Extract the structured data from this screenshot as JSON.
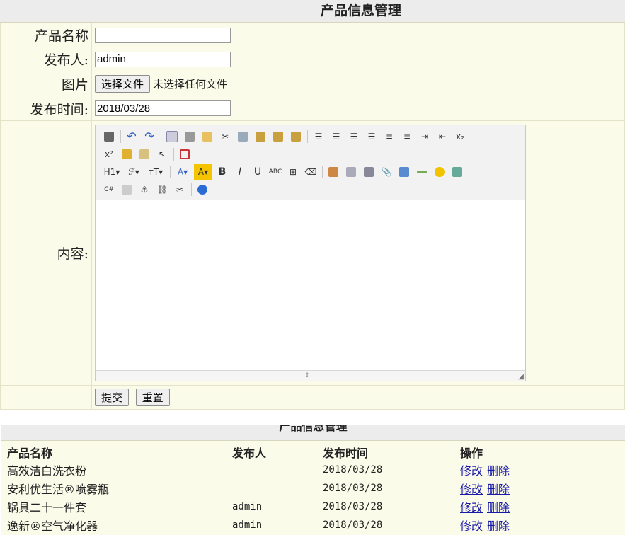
{
  "form": {
    "title": "产品信息管理",
    "labels": {
      "name": "产品名称",
      "publisher": "发布人:",
      "image": "图片",
      "time": "发布时间:",
      "content": "内容:"
    },
    "values": {
      "name": "",
      "publisher": "admin",
      "time": "2018/03/28"
    },
    "file": {
      "button": "选择文件",
      "status": "未选择任何文件"
    },
    "buttons": {
      "submit": "提交",
      "reset": "重置"
    }
  },
  "editor": {
    "toolbar_row1": [
      "source",
      "undo",
      "redo",
      "preview",
      "print",
      "template",
      "cut",
      "copy",
      "paste",
      "paste-plain",
      "paste-word",
      "align-left",
      "align-center",
      "align-right",
      "align-justify",
      "ordered-list",
      "unordered-list",
      "indent",
      "outdent",
      "subscript"
    ],
    "toolbar_row2": [
      "superscript",
      "clear-format",
      "select-all",
      "select",
      "fullscreen"
    ],
    "toolbar_row3_labels": {
      "heading": "H1▾",
      "font": "ℱ▾",
      "size": "ᴛT▾",
      "forecolor": "A▾",
      "hilite": "A▾",
      "bold": "B",
      "italic": "I",
      "underline": "U",
      "strike": "ABC"
    },
    "toolbar_row4": [
      "code",
      "page-break",
      "anchor",
      "link",
      "unlink",
      "help"
    ]
  },
  "list": {
    "title": "产品信息管理",
    "headers": [
      "产品名称",
      "发布人",
      "发布时间",
      "操作"
    ],
    "rows": [
      {
        "name": "高效洁白洗衣粉",
        "publisher": "",
        "time": "2018/03/28",
        "edit": "修改",
        "delete": "删除"
      },
      {
        "name": "安利优生活®喷雾瓶",
        "publisher": "",
        "time": "2018/03/28",
        "edit": "修改",
        "delete": "删除"
      },
      {
        "name": "锅具二十一件套",
        "publisher": "admin",
        "time": "2018/03/28",
        "edit": "修改",
        "delete": "删除"
      },
      {
        "name": "逸新®空气净化器",
        "publisher": "admin",
        "time": "2018/03/28",
        "edit": "修改",
        "delete": "删除"
      }
    ]
  }
}
